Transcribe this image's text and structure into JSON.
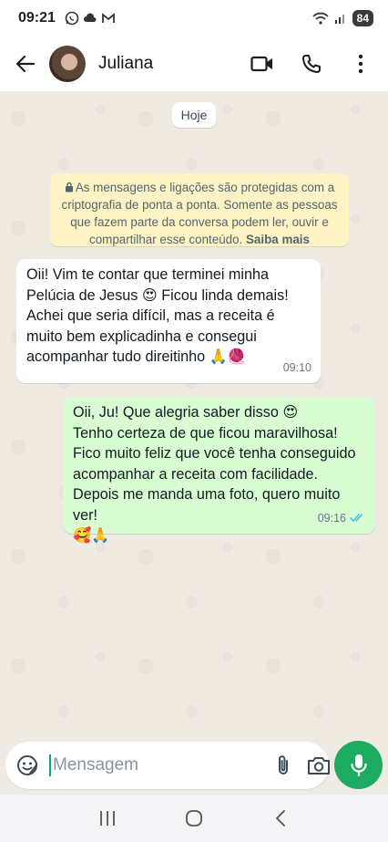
{
  "status_bar": {
    "time": "09:21",
    "battery": "84"
  },
  "header": {
    "contact_name": "Juliana"
  },
  "chat": {
    "date_chip": "Hoje",
    "encryption_notice": "As mensagens e ligações são protegidas com a criptografia de ponta a ponta. Somente as pessoas que fazem parte da conversa podem ler, ouvir e compartilhar esse conteúdo.",
    "encryption_link": "Saiba mais",
    "messages": [
      {
        "direction": "incoming",
        "text": "Oii! Vim te contar que terminei minha\nPelúcia de Jesus 😍 Ficou linda demais!\nAchei que seria difícil, mas a receita é\nmuito bem explicadinha e consegui\nacompanhar tudo direitinho 🙏🧶",
        "time": "09:10"
      },
      {
        "direction": "outgoing",
        "text": "Oii, Ju! Que alegria saber disso 😍\nTenho certeza de que ficou maravilhosa!\nFico muito feliz que você tenha conseguido\nacompanhar a receita com facilidade.\nDepois me manda uma foto, quero muito ver!\n🥰🙏",
        "time": "09:16",
        "status": "read"
      }
    ]
  },
  "composer": {
    "placeholder": "Mensagem"
  },
  "colors": {
    "incoming_bubble": "#ffffff",
    "outgoing_bubble": "#d9fdd3",
    "accent": "#1daa61",
    "read_ticks": "#53bdeb",
    "encryption_bg": "#fdf3c4"
  }
}
